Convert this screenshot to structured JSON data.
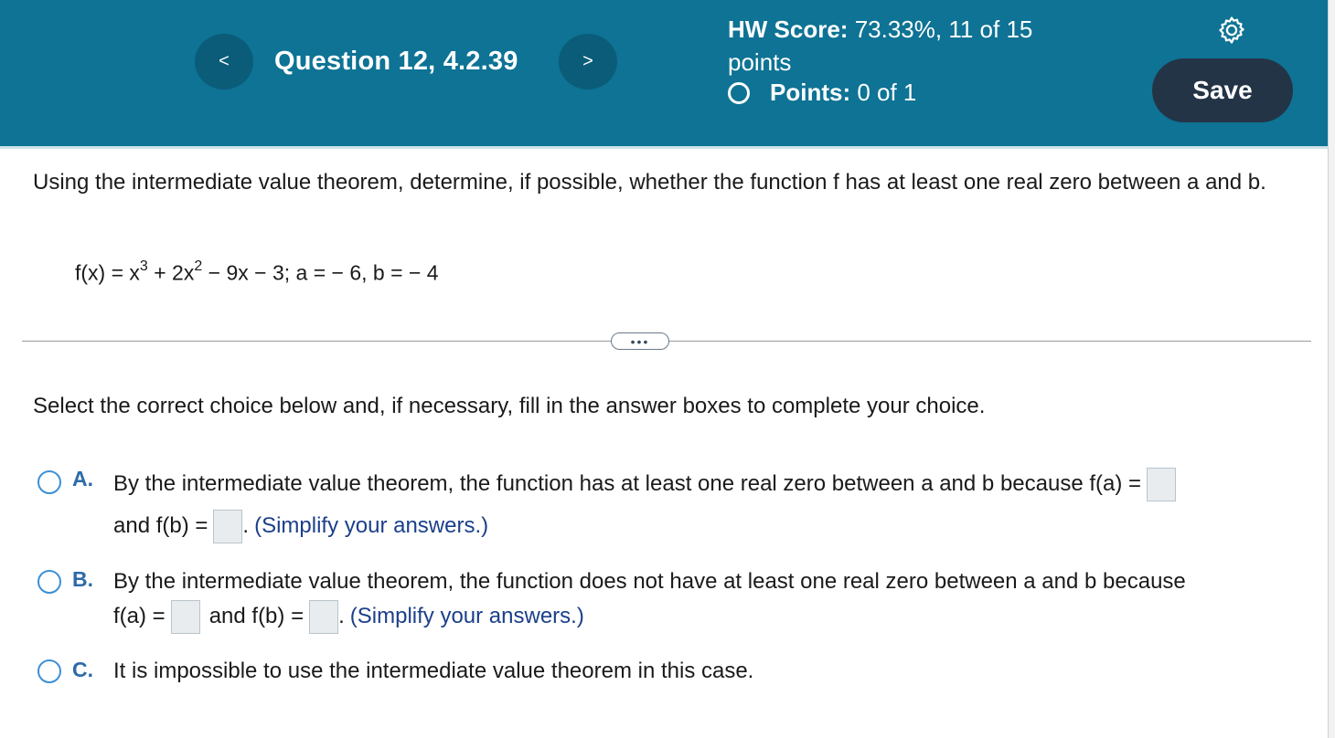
{
  "header": {
    "prev_icon": "chevron-left-icon",
    "prev_glyph": "<",
    "next_icon": "chevron-right-icon",
    "next_glyph": ">",
    "question_title": "Question 12, 4.2.39",
    "hw_score_label": "HW Score:",
    "hw_score_value": "73.33%, 11 of 15",
    "hw_score_unit": "points",
    "points_label": "Points:",
    "points_value": "0 of 1",
    "settings_icon": "gear-icon",
    "save_label": "Save",
    "colors": {
      "header_bg": "#0e7394",
      "nav_btn": "#0a5c79",
      "save_btn": "#243447"
    }
  },
  "question": {
    "prompt": "Using the intermediate value theorem, determine, if possible, whether the function f has at least one real zero between a and b.",
    "formula": {
      "lhs": "f(x) = x",
      "exp1": "3",
      "mid": " + 2x",
      "exp2": "2",
      "rest": " − 9x − 3; a = − 6, b = − 4"
    },
    "more_label": "•••",
    "instruction": "Select the correct choice below and, if necessary, fill in the answer boxes to complete your choice."
  },
  "choices": {
    "a": {
      "letter": "A.",
      "text1": "By the intermediate value theorem, the function has at least one real zero between a and b because f(a) =",
      "text2": "and f(b) =",
      "text3": ".",
      "hint": "(Simplify your answers.)"
    },
    "b": {
      "letter": "B.",
      "text1": "By the intermediate value theorem, the function does not have at least one real zero between a and b because",
      "text2": "f(a) =",
      "text3": "and f(b) =",
      "text4": ".",
      "hint": "(Simplify your answers.)"
    },
    "c": {
      "letter": "C.",
      "text1": "It is impossible to use the intermediate value theorem in this case."
    }
  }
}
